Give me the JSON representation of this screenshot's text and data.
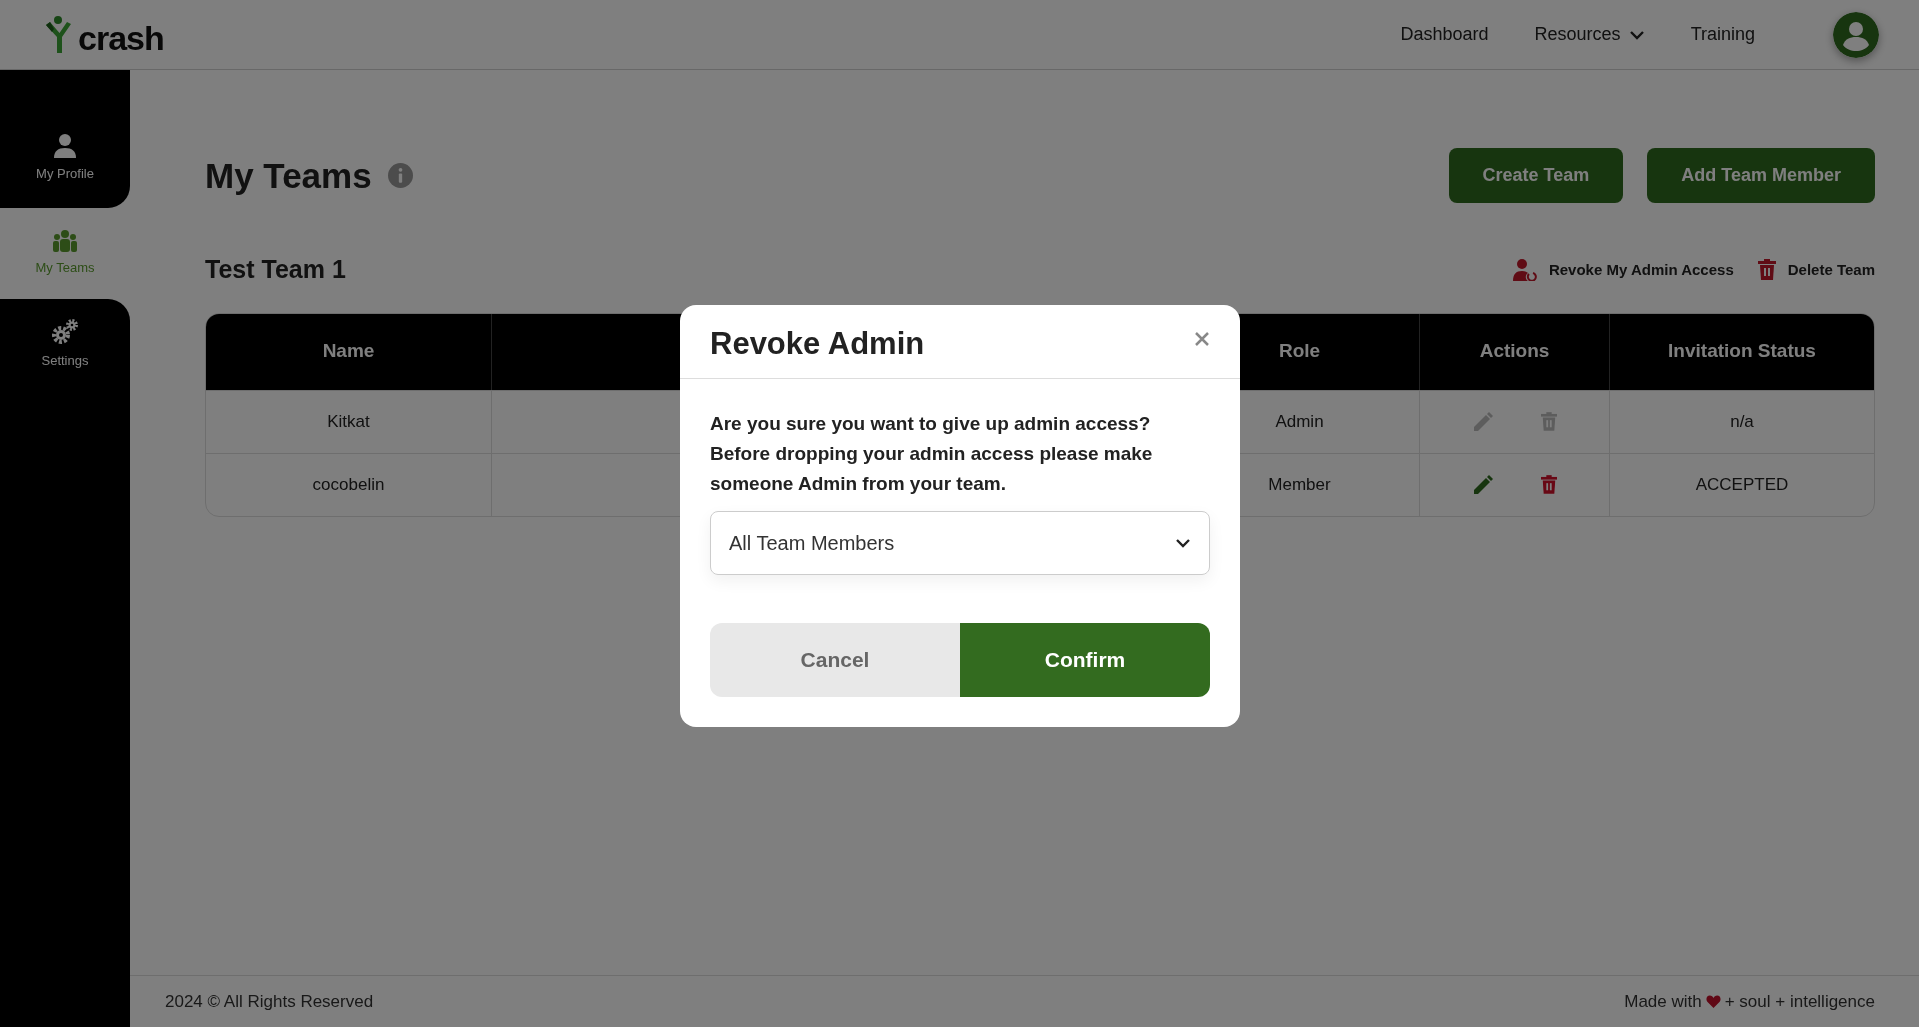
{
  "header": {
    "logo": "crash",
    "nav": [
      {
        "label": "Dashboard",
        "kind": "link"
      },
      {
        "label": "Resources",
        "kind": "dropdown"
      },
      {
        "label": "Training",
        "kind": "link"
      }
    ]
  },
  "sidebar": {
    "items": [
      {
        "label": "My Profile",
        "kind": "profile",
        "selected": false
      },
      {
        "label": "My Teams",
        "kind": "teams",
        "selected": true
      },
      {
        "label": "Settings",
        "kind": "settings",
        "selected": false
      }
    ]
  },
  "page": {
    "title": "My Teams",
    "buttons": [
      "Create Team",
      "Add Team Member"
    ]
  },
  "team": {
    "name": "Test Team 1",
    "actions": [
      {
        "label": "Revoke My Admin Access",
        "kind": "revoke"
      },
      {
        "label": "Delete Team",
        "kind": "delete"
      }
    ]
  },
  "table": {
    "columns": [
      "Name",
      "Role",
      "Actions",
      "Invitation Status"
    ],
    "rows": [
      {
        "name": "Kitkat",
        "role": "Admin",
        "disabled": true,
        "status": "n/a"
      },
      {
        "name": "cocobelin",
        "role": "Member",
        "disabled": false,
        "status": "ACCEPTED"
      }
    ]
  },
  "modal": {
    "title": "Revoke Admin",
    "message": "Are you sure you want to give up admin access? Before dropping your admin access please make someone Admin from your team.",
    "select": {
      "value": "All Team Members"
    },
    "buttons": [
      {
        "label": "Cancel",
        "kind": "secondary"
      },
      {
        "label": "Confirm",
        "kind": "primary"
      }
    ]
  },
  "footer": {
    "copyright": "2024 © All Rights Reserved",
    "credit_before": "Made with",
    "credit_after": "+ soul + intelligence"
  }
}
